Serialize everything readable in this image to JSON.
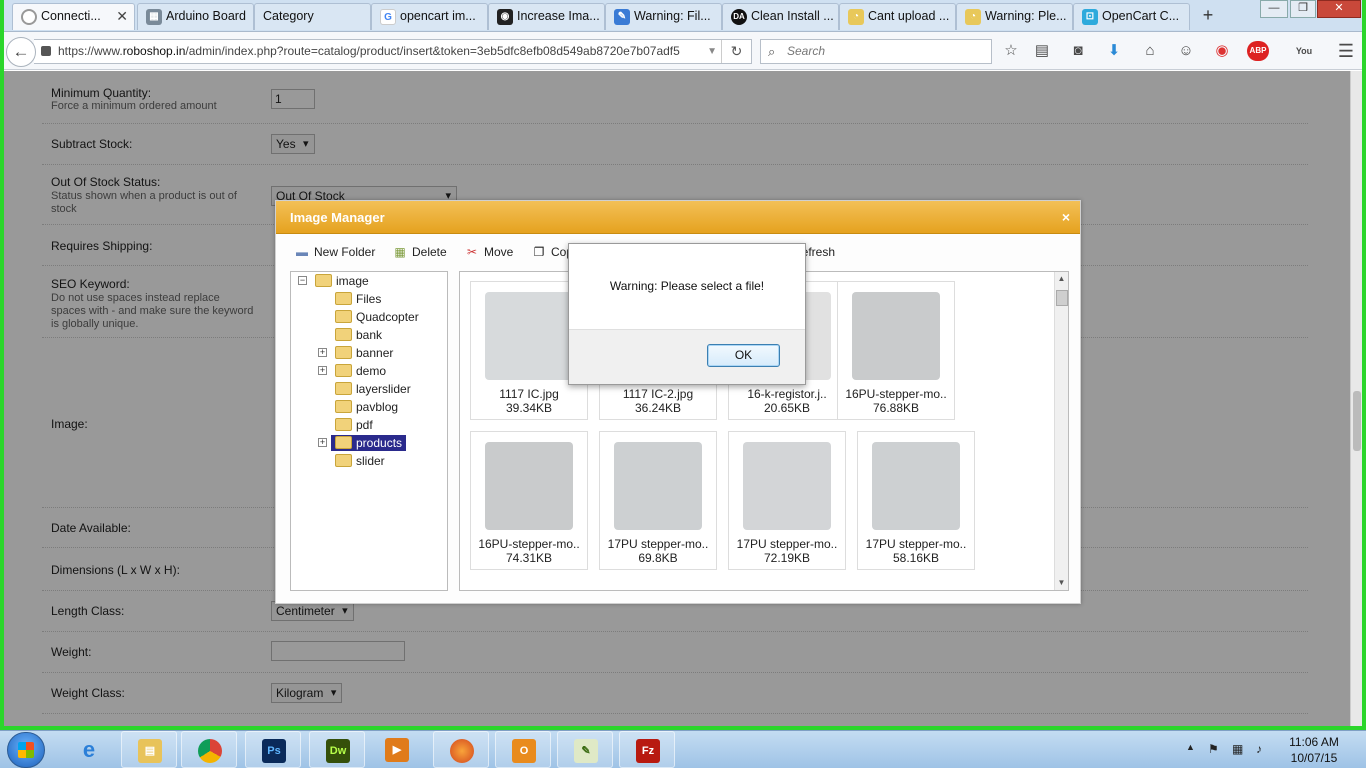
{
  "browser": {
    "tabs": [
      {
        "label": "Connecti...",
        "icon": "spinner-icon",
        "active": true
      },
      {
        "label": "Arduino Board",
        "icon": "cart-icon"
      },
      {
        "label": "Category",
        "icon": "blank-page-icon"
      },
      {
        "label": "opencart im...",
        "icon": "google-icon"
      },
      {
        "label": "Increase Ima...",
        "icon": "camera-icon"
      },
      {
        "label": "Warning: Fil...",
        "icon": "feather-icon"
      },
      {
        "label": "Clean Install ...",
        "icon": "da-icon"
      },
      {
        "label": "Cant upload ...",
        "icon": "opencart-icon"
      },
      {
        "label": "Warning: Ple...",
        "icon": "opencart-icon"
      },
      {
        "label": "OpenCart C...",
        "icon": "opencart-cart-icon"
      }
    ],
    "url_prefix": "https://www.",
    "url_host": "roboshop.in",
    "url_rest": "/admin/index.php?route=catalog/product/insert&token=3eb5dfc8efb08d549ab8720e7b07adf5",
    "search_placeholder": "Search",
    "window_controls": [
      "—",
      "❐",
      "✕"
    ],
    "toolbar_icons": [
      "star-icon",
      "reading-list-icon",
      "pocket-icon",
      "download-icon",
      "home-icon",
      "emoji-icon",
      "color-icon",
      "adblock-icon",
      "youtube-icon",
      "menu-icon"
    ]
  },
  "form": {
    "min_qty_label": "Minimum Quantity:",
    "min_qty_help": "Force a minimum ordered amount",
    "min_qty_value": "1",
    "subtract_label": "Subtract Stock:",
    "subtract_value": "Yes",
    "oos_label": "Out Of Stock Status:",
    "oos_help": "Status shown when a product is out of stock",
    "oos_value": "Out Of Stock",
    "shipping_label": "Requires Shipping:",
    "seo_label": "SEO Keyword:",
    "seo_help": "Do not use spaces instead replace spaces with - and make sure the keyword is globally unique.",
    "image_label": "Image:",
    "date_label": "Date Available:",
    "dims_label": "Dimensions (L x W x H):",
    "length_label": "Length Class:",
    "length_value": "Centimeter",
    "weight_label": "Weight:",
    "weight_class_label": "Weight Class:",
    "weight_class_value": "Kilogram"
  },
  "image_manager": {
    "title": "Image Manager",
    "close": "×",
    "tools": [
      "New Folder",
      "Delete",
      "Move",
      "Copy",
      "Refresh"
    ],
    "folders": [
      "image",
      "Files",
      "Quadcopter",
      "bank",
      "banner",
      "demo",
      "layerslider",
      "pavblog",
      "pdf",
      "products",
      "slider"
    ],
    "selected_folder": "products",
    "files": [
      {
        "name": "1117 IC.jpg",
        "size": "39.34KB"
      },
      {
        "name": "1117 IC-2.jpg",
        "size": "36.24KB"
      },
      {
        "name": "16-k-registor.j..",
        "size": "20.65KB"
      },
      {
        "name": "16PU-stepper-mo..",
        "size": "76.88KB"
      },
      {
        "name": "16PU-stepper-mo..",
        "size": "74.31KB"
      },
      {
        "name": "17PU stepper-mo..",
        "size": "69.8KB"
      },
      {
        "name": "17PU stepper-mo..",
        "size": "72.19KB"
      },
      {
        "name": "17PU stepper-mo..",
        "size": "58.16KB"
      }
    ]
  },
  "alert": {
    "message": "Warning: Please select a file!",
    "ok_label": "OK"
  },
  "taskbar": {
    "apps": [
      "ie-icon",
      "explorer-icon",
      "chrome-icon",
      "photoshop-icon",
      "dreamweaver-icon",
      "media-player-icon",
      "firefox-icon",
      "outlook-icon",
      "notepad-icon",
      "filezilla-icon"
    ],
    "time": "11:06 AM",
    "date": "10/07/15"
  }
}
